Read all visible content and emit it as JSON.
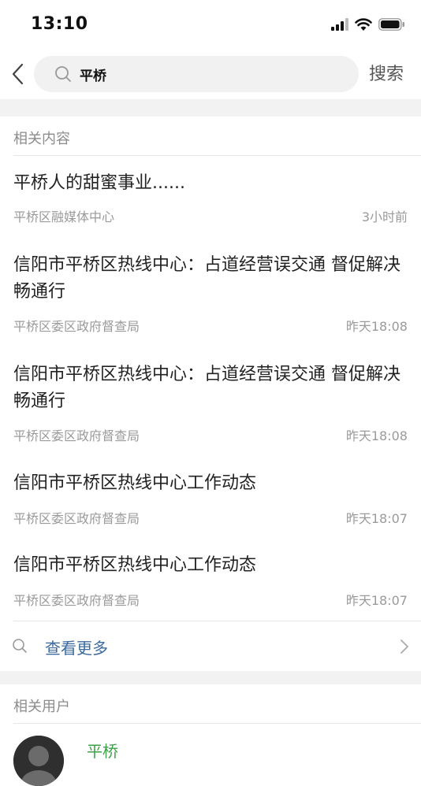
{
  "status_bar": {
    "time": "13:10"
  },
  "search": {
    "query": "平桥",
    "button_label": "搜索"
  },
  "related_content": {
    "heading": "相关内容",
    "items": [
      {
        "title": "平桥人的甜蜜事业......",
        "source": "平桥区融媒体中心",
        "time": "3小时前"
      },
      {
        "title": "信阳市平桥区热线中心：占道经营误交通 督促解决畅通行",
        "source": "平桥区委区政府督查局",
        "time": "昨天18:08"
      },
      {
        "title": "信阳市平桥区热线中心：占道经营误交通 督促解决畅通行",
        "source": "平桥区委区政府督查局",
        "time": "昨天18:08"
      },
      {
        "title": "信阳市平桥区热线中心工作动态",
        "source": "平桥区委区政府督查局",
        "time": "昨天18:07"
      },
      {
        "title": "信阳市平桥区热线中心工作动态",
        "source": "平桥区委区政府督查局",
        "time": "昨天18:07"
      }
    ],
    "more_label": "查看更多"
  },
  "related_users": {
    "heading": "相关用户",
    "first_user_name": "平桥"
  },
  "colors": {
    "link": "#3c6a9e",
    "user_name": "#3ea04a",
    "section_gap": "#f2f2f2"
  }
}
